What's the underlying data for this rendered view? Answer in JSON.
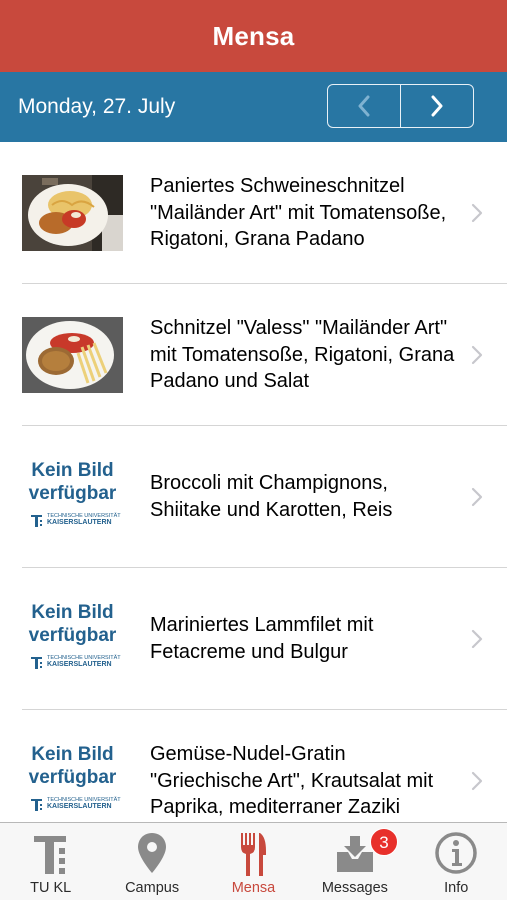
{
  "header": {
    "title": "Mensa"
  },
  "datebar": {
    "date": "Monday, 27. July"
  },
  "no_image": {
    "line1": "Kein Bild",
    "line2": "verfügbar",
    "logo_line1": "TECHNISCHE UNIVERSITÄT",
    "logo_line2": "KAISERSLAUTERN"
  },
  "meals": [
    {
      "text": "Paniertes Schweineschnitzel \"Mailänder Art\" mit Tomatensoße, Rigatoni, Grana Padano",
      "image": "photo"
    },
    {
      "text": "Schnitzel \"Valess\" \"Mailänder Art\" mit Tomatensoße, Rigatoni, Grana Padano und Salat",
      "image": "photo"
    },
    {
      "text": "Broccoli mit Champignons, Shiitake und Karotten, Reis",
      "image": "none"
    },
    {
      "text": "Mariniertes Lammfilet mit Fetacreme und Bulgur",
      "image": "none"
    },
    {
      "text": "Gemüse-Nudel-Gratin \"Griechische Art\", Krautsalat mit Paprika, mediterraner Zaziki",
      "image": "none"
    }
  ],
  "tabs": [
    {
      "label": "TU KL",
      "icon": "tu-kl-logo-icon"
    },
    {
      "label": "Campus",
      "icon": "map-pin-icon"
    },
    {
      "label": "Mensa",
      "icon": "fork-knife-icon",
      "active": true
    },
    {
      "label": "Messages",
      "icon": "inbox-download-icon",
      "badge": "3"
    },
    {
      "label": "Info",
      "icon": "info-icon"
    }
  ],
  "colors": {
    "header": "#c8493d",
    "datebar": "#2876a3",
    "active_tab": "#c8493d",
    "tab_icon": "#8a8a8a",
    "badge": "#e8302b",
    "logo_text": "#23618e"
  }
}
